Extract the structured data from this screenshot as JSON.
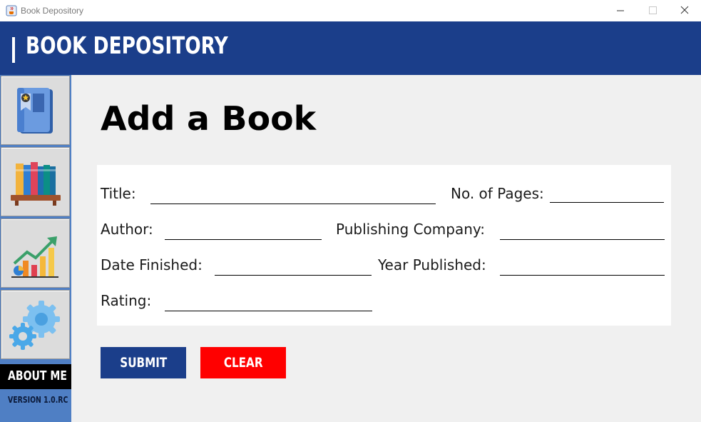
{
  "window": {
    "title": "Book Depository",
    "icon": "java-cup-icon"
  },
  "header": {
    "title": "BOOK DEPOSITORY"
  },
  "sidebar": {
    "items": [
      {
        "name": "add-book",
        "icon": "book-with-star-icon"
      },
      {
        "name": "bookshelf",
        "icon": "bookshelf-icon"
      },
      {
        "name": "statistics",
        "icon": "growth-chart-icon"
      },
      {
        "name": "settings",
        "icon": "gears-icon"
      }
    ],
    "about_label": "ABOUT ME",
    "version_label": "VERSION 1.0.RC"
  },
  "main": {
    "title": "Add a Book",
    "form": {
      "title_label": "Title:",
      "pages_label": "No. of Pages:",
      "author_label": "Author:",
      "company_label": "Publishing Company:",
      "date_label": "Date Finished:",
      "year_label": "Year Published:",
      "rating_label": "Rating:"
    },
    "submit_label": "SUBMIT",
    "clear_label": "CLEAR"
  },
  "colors": {
    "header": "#1b3e8a",
    "sidebar": "#4f7fc4",
    "submit": "#1b3e8a",
    "clear": "#ff0000"
  }
}
